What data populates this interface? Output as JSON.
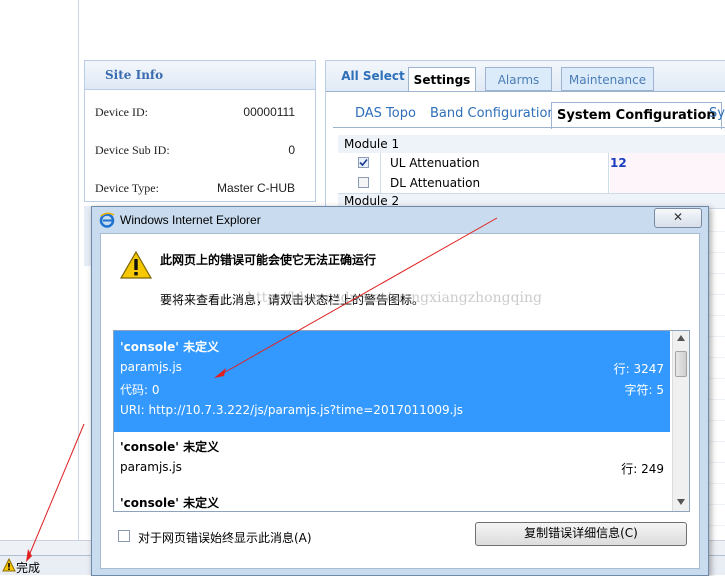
{
  "site_info": {
    "title": "Site Info",
    "rows": [
      {
        "label": "Device ID:",
        "value": "00000111"
      },
      {
        "label": "Device Sub ID:",
        "value": "0"
      },
      {
        "label": "Device Type:",
        "value": "Master C-HUB"
      }
    ]
  },
  "tabs": {
    "all_select": "All Select",
    "items": [
      "Settings",
      "Alarms",
      "Maintenance"
    ]
  },
  "subtabs": [
    "DAS Topo",
    "Band Configuration",
    "System Configuration",
    "Sy"
  ],
  "grid": {
    "module1": "Module 1",
    "rows": [
      {
        "label": "UL Attenuation",
        "value": "12",
        "checked": true
      },
      {
        "label": "DL Attenuation",
        "value": "",
        "checked": false
      }
    ],
    "module2": "Module 2"
  },
  "dialog": {
    "title": "Windows Internet Explorer",
    "close_glyph": "✕",
    "heading": "此网页上的错误可能会使它无法正确运行",
    "subtext": "要将来查看此消息，请双击状态栏上的警告图标。",
    "watermark": "http://blog.csdn.net/wangxiangzhongqing",
    "errors": [
      {
        "title": "'console' 未定义",
        "file": "paramjs.js",
        "line": "行: 3247",
        "code": "代码: 0",
        "char": "字符: 5",
        "uri": "URI: http://10.7.3.222/js/paramjs.js?time=2017011009.js"
      },
      {
        "title": "'console' 未定义",
        "file": "paramjs.js",
        "line": "行: 249"
      },
      {
        "title": "'console' 未定义"
      }
    ],
    "always_show": "对于网页错误始终显示此消息(A)",
    "copy_button": "复制错误详细信息(C)"
  },
  "statusbar": {
    "text": "完成"
  },
  "colors": {
    "accent": "#3399ff",
    "tab_blue": "#2e6fb9",
    "dialog_frame": "#c8dbef",
    "arrow": "#e02020"
  }
}
